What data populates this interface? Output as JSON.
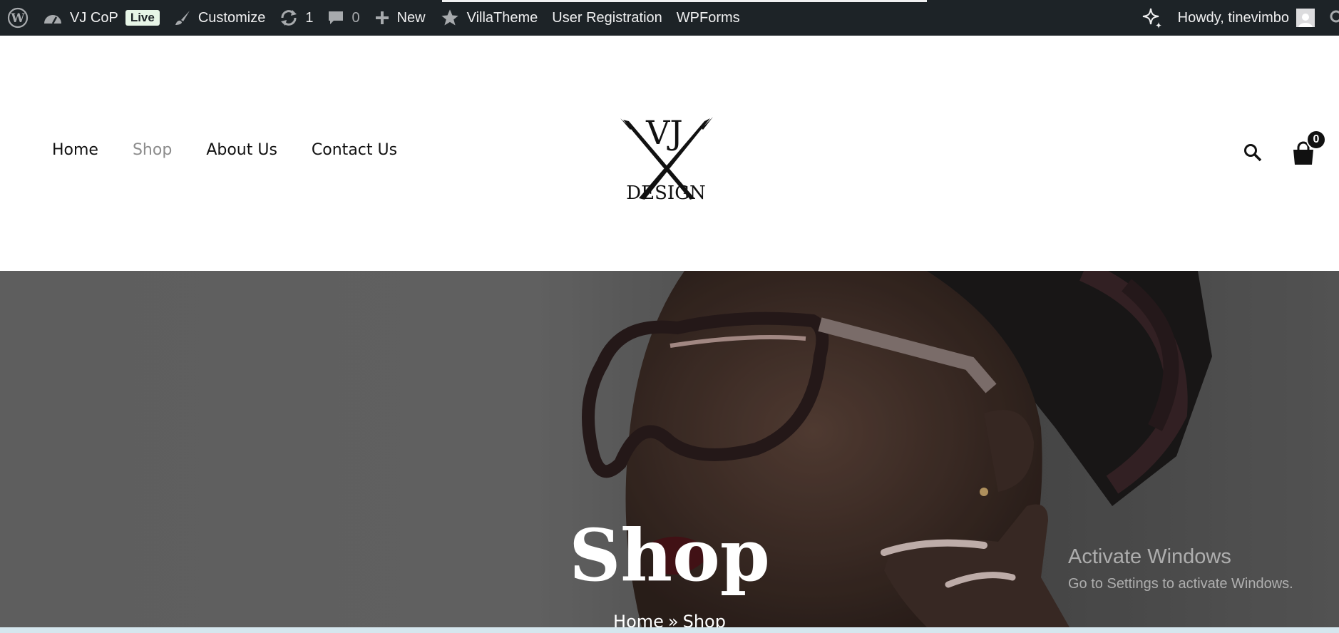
{
  "adminbar": {
    "site_name": "VJ CoP",
    "live_badge": "Live",
    "customize": "Customize",
    "updates_count": "1",
    "comments_count": "0",
    "new": "New",
    "villatheme": "VillaTheme",
    "user_registration": "User Registration",
    "wpforms": "WPForms",
    "howdy": "Howdy, tinevimbo",
    "icons": [
      "wordpress-logo",
      "dashboard-icon",
      "brush-icon",
      "updates-icon",
      "comment-icon",
      "plus-icon",
      "star-icon",
      "sparkle-icon",
      "search-icon"
    ]
  },
  "header": {
    "nav": [
      "Home",
      "Shop",
      "About Us",
      "Contact Us"
    ],
    "current_nav": "Shop",
    "logo_top": "VJ",
    "logo_bottom": "DESIGN",
    "cart_count": "0"
  },
  "hero": {
    "title": "Shop",
    "breadcrumb": [
      "Home",
      "Shop"
    ],
    "breadcrumb_sep": "»"
  },
  "watermark": {
    "title": "Activate Windows",
    "subtitle": "Go to Settings to activate Windows."
  },
  "colors": {
    "adminbar_bg": "#1d2327",
    "live_badge_bg": "#e7f5e7",
    "nav_current": "#8c8c8c"
  }
}
